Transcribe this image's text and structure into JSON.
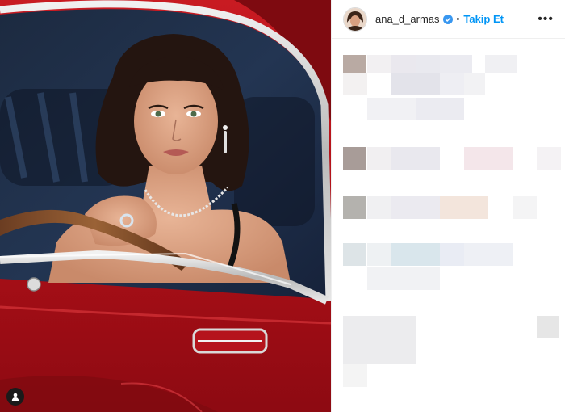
{
  "post": {
    "author": {
      "username": "ana_d_armas",
      "verified": true
    },
    "separator": "•",
    "follow_label": "Takip Et",
    "more_label": "•••"
  },
  "icons": {
    "avatar": "profile-avatar",
    "verified": "verified-badge-icon",
    "more": "more-options-icon",
    "tag": "person-tag-icon"
  },
  "colors": {
    "follow": "#0095f6",
    "verified": "#3897f0",
    "car_red": "#b3141d"
  }
}
